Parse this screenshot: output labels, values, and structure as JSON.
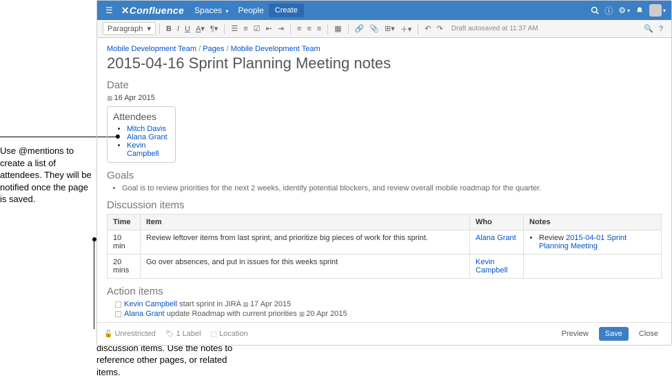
{
  "nav": {
    "logo": "Confluence",
    "spaces": "Spaces",
    "spaces_caret": "▾",
    "people": "People",
    "create": "Create"
  },
  "toolbar": {
    "paragraph": "Paragraph",
    "paragraph_caret": "▾",
    "autosave": "Draft autosaved at 11:37 AM"
  },
  "breadcrumb": {
    "a": "Mobile Development Team",
    "sep1": " / ",
    "b": "Pages",
    "sep2": " / ",
    "c": "Mobile Development Team"
  },
  "page": {
    "title": "2015-04-16 Sprint Planning Meeting notes"
  },
  "sections": {
    "date": "Date",
    "attendees": "Attendees",
    "goals": "Goals",
    "discussion": "Discussion items",
    "action": "Action items"
  },
  "date": {
    "value": "16 Apr 2015"
  },
  "attendees": [
    "Mitch Davis",
    "Alana Grant",
    "Kevin Campbell"
  ],
  "goals": [
    "Goal is to review priorities for the next 2 weeks, identify potential blockers, and review overall mobile roadmap for the quarter."
  ],
  "di_headers": {
    "time": "Time",
    "item": "Item",
    "who": "Who",
    "notes": "Notes"
  },
  "di_rows": [
    {
      "time": "10 min",
      "item": "Review leftover items from last sprint, and prioritize big pieces of work for this sprint.",
      "who": "Alana Grant",
      "notes_prefix": "Review ",
      "notes_link": "2015-04-01 Sprint Planning Meeting"
    },
    {
      "time": "20 mins",
      "item": "Go over absences, and put in issues for this weeks sprint",
      "who": "Kevin Campbell",
      "notes_prefix": "",
      "notes_link": ""
    }
  ],
  "actions": [
    {
      "who": "Kevin Campbell",
      "text": " start sprint in JIRA ",
      "date": "17 Apr 2015"
    },
    {
      "who": "Alana Grant",
      "text": " update Roadmap with current priorities ",
      "date": "20 Apr 2015"
    }
  ],
  "footer": {
    "restrictions": "Unrestricted",
    "labels": "1 Label",
    "location": "Location",
    "preview": "Preview",
    "save": "Save",
    "close": "Close"
  },
  "callouts": {
    "attendees": "Use @mentions to create a list of attendees. They will be notified once the page is saved.",
    "discussion": "Use the table provided to list discussion items. Use the notes to reference other pages, or related items."
  }
}
